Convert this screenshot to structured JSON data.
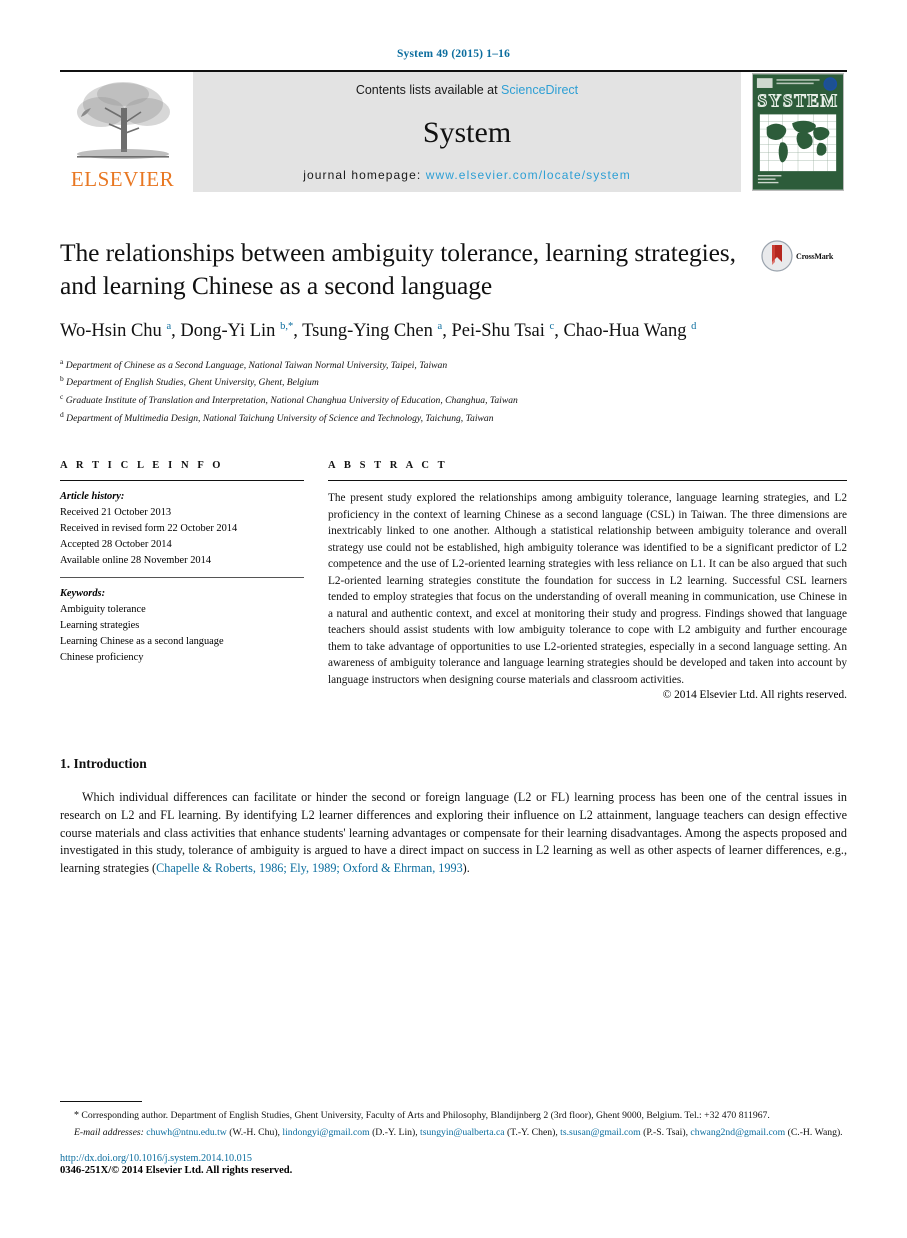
{
  "running_head": "System 49 (2015) 1–16",
  "masthead": {
    "contents_prefix": "Contents lists available at ",
    "sciencedirect": "ScienceDirect",
    "journal_name": "System",
    "homepage_prefix": "journal homepage: ",
    "homepage_url": "www.elsevier.com/locate/system",
    "publisher": "ELSEVIER",
    "cover_title": "SYSTEM",
    "link_color": "#2e9fd4",
    "publisher_color": "#E87722",
    "cover_color": "#2d5c3a"
  },
  "article": {
    "title": "The relationships between ambiguity tolerance, learning strategies, and learning Chinese as a second language",
    "crossmark_label": "CrossMark",
    "authors": [
      {
        "name": "Wo-Hsin Chu",
        "marks": "a",
        "corresponding": false,
        "sep": ", "
      },
      {
        "name": "Dong-Yi Lin",
        "marks": "b,",
        "corresponding": true,
        "sep": ", "
      },
      {
        "name": "Tsung-Ying Chen",
        "marks": "a",
        "corresponding": false,
        "sep": ", "
      },
      {
        "name": "Pei-Shu Tsai",
        "marks": "c",
        "corresponding": false,
        "sep": ", "
      },
      {
        "name": "Chao-Hua Wang",
        "marks": "d",
        "corresponding": false,
        "sep": ""
      }
    ],
    "affiliations": [
      {
        "mark": "a",
        "text": "Department of Chinese as a Second Language, National Taiwan Normal University, Taipei, Taiwan"
      },
      {
        "mark": "b",
        "text": "Department of English Studies, Ghent University, Ghent, Belgium"
      },
      {
        "mark": "c",
        "text": "Graduate Institute of Translation and Interpretation, National Changhua University of Education, Changhua, Taiwan"
      },
      {
        "mark": "d",
        "text": "Department of Multimedia Design, National Taichung University of Science and Technology, Taichung, Taiwan"
      }
    ]
  },
  "article_info": {
    "heading": "A R T I C L E    I N F O",
    "history_label": "Article history:",
    "history": [
      "Received 21 October 2013",
      "Received in revised form 22 October 2014",
      "Accepted 28 October 2014",
      "Available online 28 November 2014"
    ],
    "keywords_label": "Keywords:",
    "keywords": [
      "Ambiguity tolerance",
      "Learning strategies",
      "Learning Chinese as a second language",
      "Chinese proficiency"
    ]
  },
  "abstract": {
    "heading": "A B S T R A C T",
    "text": "The present study explored the relationships among ambiguity tolerance, language learning strategies, and L2 proficiency in the context of learning Chinese as a second language (CSL) in Taiwan. The three dimensions are inextricably linked to one another. Although a statistical relationship between ambiguity tolerance and overall strategy use could not be established, high ambiguity tolerance was identified to be a significant predictor of L2 competence and the use of L2-oriented learning strategies with less reliance on L1. It can be also argued that such L2-oriented learning strategies constitute the foundation for success in L2 learning. Successful CSL learners tended to employ strategies that focus on the understanding of overall meaning in communication, use Chinese in a natural and authentic context, and excel at monitoring their study and progress. Findings showed that language teachers should assist students with low ambiguity tolerance to cope with L2 ambiguity and further encourage them to take advantage of opportunities to use L2-oriented strategies, especially in a second language setting. An awareness of ambiguity tolerance and language learning strategies should be developed and taken into account by language instructors when designing course materials and classroom activities.",
    "copyright": "© 2014 Elsevier Ltd. All rights reserved."
  },
  "introduction": {
    "heading": "1. Introduction",
    "paragraph_before_cite": "Which individual differences can facilitate or hinder the second or foreign language (L2 or FL) learning process has been one of the central issues in research on L2 and FL learning. By identifying L2 learner differences and exploring their influence on L2 attainment, language teachers can design effective course materials and class activities that enhance students' learning advantages or compensate for their learning disadvantages. Among the aspects proposed and investigated in this study, tolerance of ambiguity is argued to have a direct impact on success in L2 learning as well as other aspects of learner differences, e.g., learning strategies (",
    "citations": "Chapelle & Roberts, 1986; Ely, 1989; Oxford & Ehrman, 1993",
    "paragraph_after_cite": ")."
  },
  "footnotes": {
    "corresponding_star": "*",
    "corresponding_text": "Corresponding author. Department of English Studies, Ghent University, Faculty of Arts and Philosophy, Blandijnberg 2 (3rd floor), Ghent 9000, Belgium. Tel.: +32 470 811967.",
    "emails_label": "E-mail addresses:",
    "emails": [
      {
        "address": "chuwh@ntnu.edu.tw",
        "person": "(W.-H. Chu)",
        "sep": ", "
      },
      {
        "address": "lindongyi@gmail.com",
        "person": "(D.-Y. Lin)",
        "sep": ", "
      },
      {
        "address": "tsungyin@ualberta.ca",
        "person": "(T.-Y. Chen)",
        "sep": ", "
      },
      {
        "address": "ts.susan@gmail.com",
        "person": "(P.-S. Tsai)",
        "sep": ", "
      },
      {
        "address": "chwang2nd@gmail.com",
        "person": "(C.-H. Wang)",
        "sep": "."
      }
    ],
    "doi": "http://dx.doi.org/10.1016/j.system.2014.10.015",
    "issn_line": "0346-251X/© 2014 Elsevier Ltd. All rights reserved."
  }
}
